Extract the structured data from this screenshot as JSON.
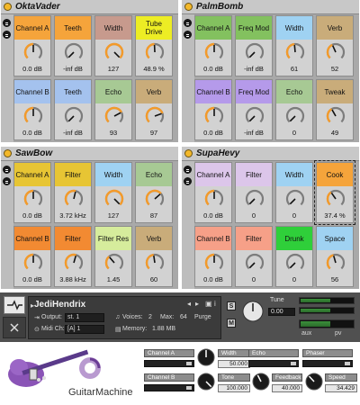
{
  "racks": [
    {
      "name": "OktaVader",
      "macros": [
        {
          "label": "Channel A",
          "value": "0.0 dB",
          "color": "#f5a43b",
          "level": 0.5
        },
        {
          "label": "Teeth",
          "value": "-inf dB",
          "color": "#f5a43b",
          "level": 0.0
        },
        {
          "label": "Width",
          "value": "127",
          "color": "#c79a8d",
          "level": 1.0
        },
        {
          "label": "Tube Drive",
          "value": "48.9 %",
          "color": "#eded24",
          "level": 0.49
        },
        {
          "label": "Channel B",
          "value": "0.0 dB",
          "color": "#a4c2ee",
          "level": 0.5
        },
        {
          "label": "Teeth",
          "value": "-inf dB",
          "color": "#a4c2ee",
          "level": 0.0
        },
        {
          "label": "Echo",
          "value": "93",
          "color": "#a7c994",
          "level": 0.73
        },
        {
          "label": "Verb",
          "value": "97",
          "color": "#c9ac7a",
          "level": 0.76
        }
      ]
    },
    {
      "name": "PalmBomb",
      "macros": [
        {
          "label": "Channel A",
          "value": "0.0 dB",
          "color": "#83c15f",
          "level": 0.5
        },
        {
          "label": "Freq Mod",
          "value": "-inf dB",
          "color": "#83c15f",
          "level": 0.0
        },
        {
          "label": "Width",
          "value": "61",
          "color": "#9fd2f2",
          "level": 0.48
        },
        {
          "label": "Verb",
          "value": "52",
          "color": "#c9ac7a",
          "level": 0.41
        },
        {
          "label": "Channel B",
          "value": "0.0 dB",
          "color": "#b59aea",
          "level": 0.5
        },
        {
          "label": "Freq Mod",
          "value": "-inf dB",
          "color": "#b59aea",
          "level": 0.0
        },
        {
          "label": "Echo",
          "value": "0",
          "color": "#a7c994",
          "level": 0.0
        },
        {
          "label": "Tweak",
          "value": "49",
          "color": "#c9ac7a",
          "level": 0.39
        }
      ]
    },
    {
      "name": "SawBow",
      "macros": [
        {
          "label": "Channel A",
          "value": "0.0 dB",
          "color": "#e7c534",
          "level": 0.5
        },
        {
          "label": "Filter",
          "value": "3.72 kHz",
          "color": "#e7c534",
          "level": 0.55
        },
        {
          "label": "Width",
          "value": "127",
          "color": "#9fd2f2",
          "level": 1.0
        },
        {
          "label": "Echo",
          "value": "87",
          "color": "#a7c994",
          "level": 0.68
        },
        {
          "label": "Channel B",
          "value": "0.0 dB",
          "color": "#f28a32",
          "level": 0.5
        },
        {
          "label": "Filter",
          "value": "3.88 kHz",
          "color": "#f28a32",
          "level": 0.56
        },
        {
          "label": "Filter Res",
          "value": "1.45",
          "color": "#d6ec9c",
          "level": 0.35
        },
        {
          "label": "Verb",
          "value": "60",
          "color": "#c9ac7a",
          "level": 0.47
        }
      ]
    },
    {
      "name": "SupaHevy",
      "macros": [
        {
          "label": "Channel A",
          "value": "0.0 dB",
          "color": "#dcc6ea",
          "level": 0.5
        },
        {
          "label": "Filter",
          "value": "0",
          "color": "#dcc6ea",
          "level": 0.0
        },
        {
          "label": "Width",
          "value": "0",
          "color": "#9fd2f2",
          "level": 0.0
        },
        {
          "label": "Cook",
          "value": "37.4 %",
          "color": "#f5a43b",
          "level": 0.37,
          "selected": true
        },
        {
          "label": "Channel B",
          "value": "0.0 dB",
          "color": "#f6a088",
          "level": 0.5
        },
        {
          "label": "Filter",
          "value": "0",
          "color": "#f6a088",
          "level": 0.0
        },
        {
          "label": "Drunk",
          "value": "0",
          "color": "#2fcf3a",
          "level": 0.0
        },
        {
          "label": "Space",
          "value": "56",
          "color": "#9fd2f2",
          "level": 0.44
        }
      ]
    }
  ],
  "kontakt": {
    "instrument": "JediHendrix",
    "output_label": "Output:",
    "output_value": "st. 1",
    "voices_label": "Voices:",
    "voices_value": "2",
    "max_label": "Max:",
    "max_value": "64",
    "purge_label": "Purge",
    "midi_label": "Midi Ch:",
    "midi_value": "[A] 1",
    "memory_label": "Memory:",
    "memory_value": "1.88 MB",
    "solo": "S",
    "mute": "M",
    "tune_label": "Tune",
    "tune_value": "0.00"
  },
  "guitar_machine": {
    "brand": "GuitarMachine",
    "controls": [
      {
        "label": "Channel A",
        "fader": 0.95
      },
      {
        "label": "Width",
        "value": "50.000",
        "knob": 0.5
      },
      {
        "label": "Echo",
        "fader": 0.95
      },
      {
        "label": "Phaser",
        "fader": 0.9
      },
      {
        "label": "Channel B",
        "fader": 0.95
      },
      {
        "label": "Tone",
        "value": "100.000",
        "knob": 1.0
      },
      {
        "label": "Feedback",
        "value": "40.000",
        "knob": 0.4
      },
      {
        "label": "Speed",
        "value": "34.429",
        "knob": 0.34
      }
    ]
  }
}
